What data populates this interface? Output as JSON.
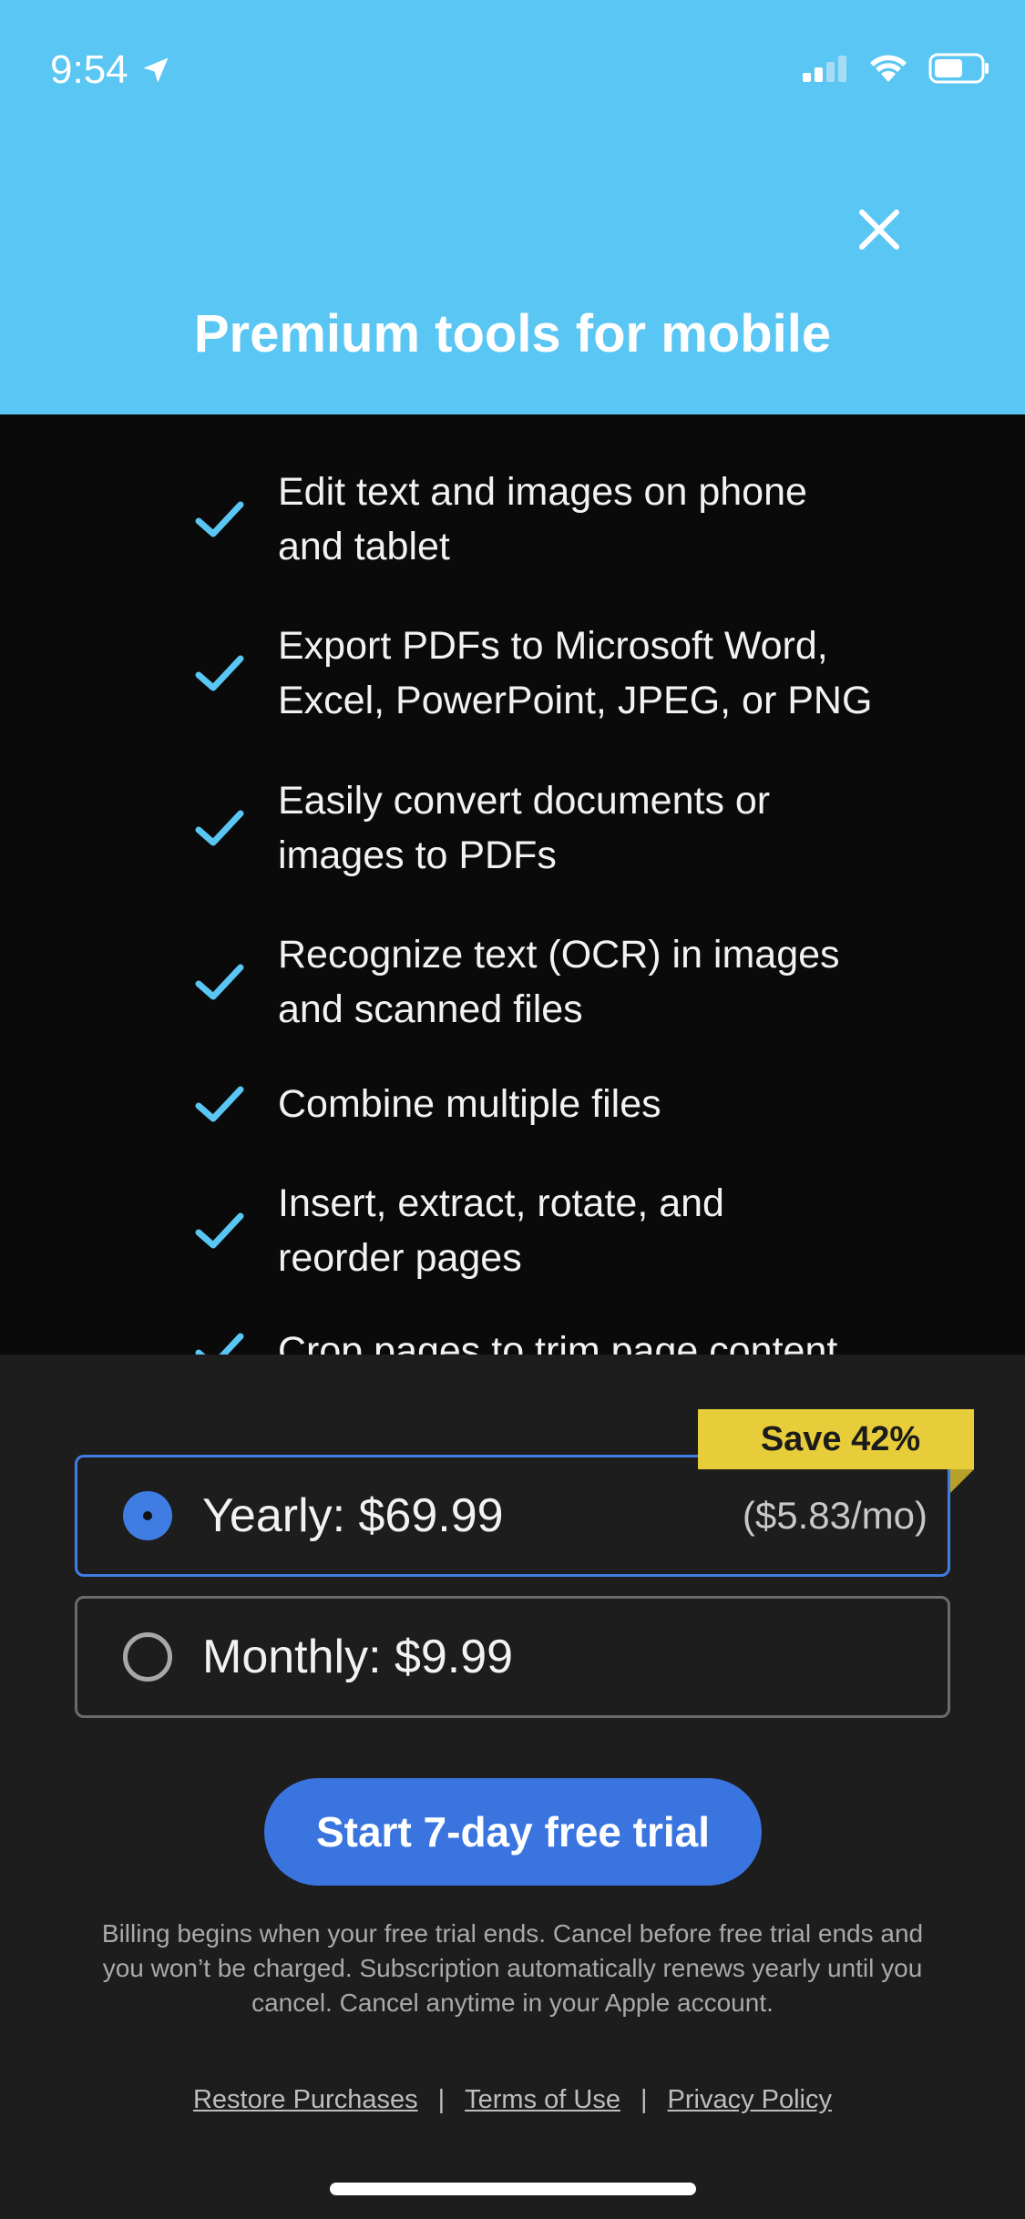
{
  "status_bar": {
    "time": "9:54"
  },
  "header": {
    "title": "Premium tools for mobile"
  },
  "features": [
    {
      "line1": "Edit text and images on phone",
      "line2": "and tablet"
    },
    {
      "line1": "Export PDFs to Microsoft Word,",
      "line2": "Excel, PowerPoint, JPEG, or PNG"
    },
    {
      "line1": "Easily convert documents or",
      "line2": "images to PDFs"
    },
    {
      "line1": "Recognize text (OCR) in images",
      "line2": "and scanned files"
    },
    {
      "line1": "Combine multiple files",
      "line2": ""
    },
    {
      "line1": "Insert, extract, rotate, and",
      "line2": "reorder pages"
    },
    {
      "line1": "Crop pages to trim page content",
      "line2": ""
    }
  ],
  "plans": {
    "badge": "Save 42%",
    "yearly": {
      "label": "Yearly: $69.99",
      "sub": "($5.83/mo)",
      "selected": true
    },
    "monthly": {
      "label": "Monthly: $9.99",
      "selected": false
    }
  },
  "cta": {
    "label": "Start 7-day free trial"
  },
  "legal": {
    "line1": "Billing begins when your free trial ends. Cancel before free trial ends and",
    "line2": "you won’t be charged. Subscription automatically renews yearly until you",
    "line3": "cancel. Cancel anytime in your Apple account."
  },
  "links": {
    "restore": "Restore Purchases",
    "separator": "|",
    "terms": "Terms of Use",
    "privacy": "Privacy Policy"
  },
  "colors": {
    "header_bg": "#5ac6f3",
    "check": "#5ac6f3",
    "accent_blue": "#3a74df",
    "badge": "#e8cd3a"
  }
}
